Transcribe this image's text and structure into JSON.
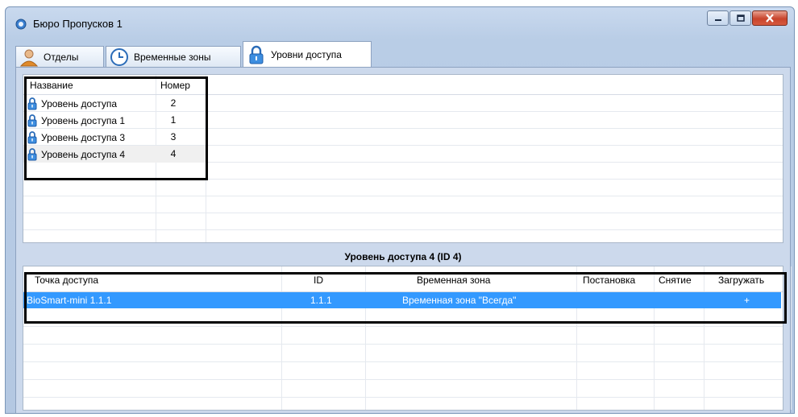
{
  "window": {
    "title": "Бюро Пропусков 1"
  },
  "tabs": [
    {
      "label": "Отделы",
      "icon": "person-icon"
    },
    {
      "label": "Временные зоны",
      "icon": "clock-icon"
    },
    {
      "label": "Уровни доступа",
      "icon": "padlock-icon"
    }
  ],
  "levels_table": {
    "columns": [
      "Название",
      "Номер"
    ],
    "rows": [
      {
        "name": "Уровень доступа",
        "number": "2"
      },
      {
        "name": "Уровень доступа 1",
        "number": "1"
      },
      {
        "name": "Уровень доступа 3",
        "number": "3"
      },
      {
        "name": "Уровень доступа 4",
        "number": "4"
      }
    ]
  },
  "selected_level_caption": "Уровень доступа 4 (ID 4)",
  "points_table": {
    "columns": [
      "Точка доступа",
      "ID",
      "Временная зона",
      "Постановка",
      "Снятие",
      "Загружать"
    ],
    "rows": [
      {
        "point": "BioSmart-mini 1.1.1",
        "id": "1.1.1",
        "zone": "Временная зона \"Всегда\"",
        "arm": "",
        "disarm": "",
        "load": "+"
      }
    ]
  },
  "colors": {
    "selection": "#3399ff",
    "window_frame": "#b9cde6",
    "close_button": "#c8442c"
  }
}
